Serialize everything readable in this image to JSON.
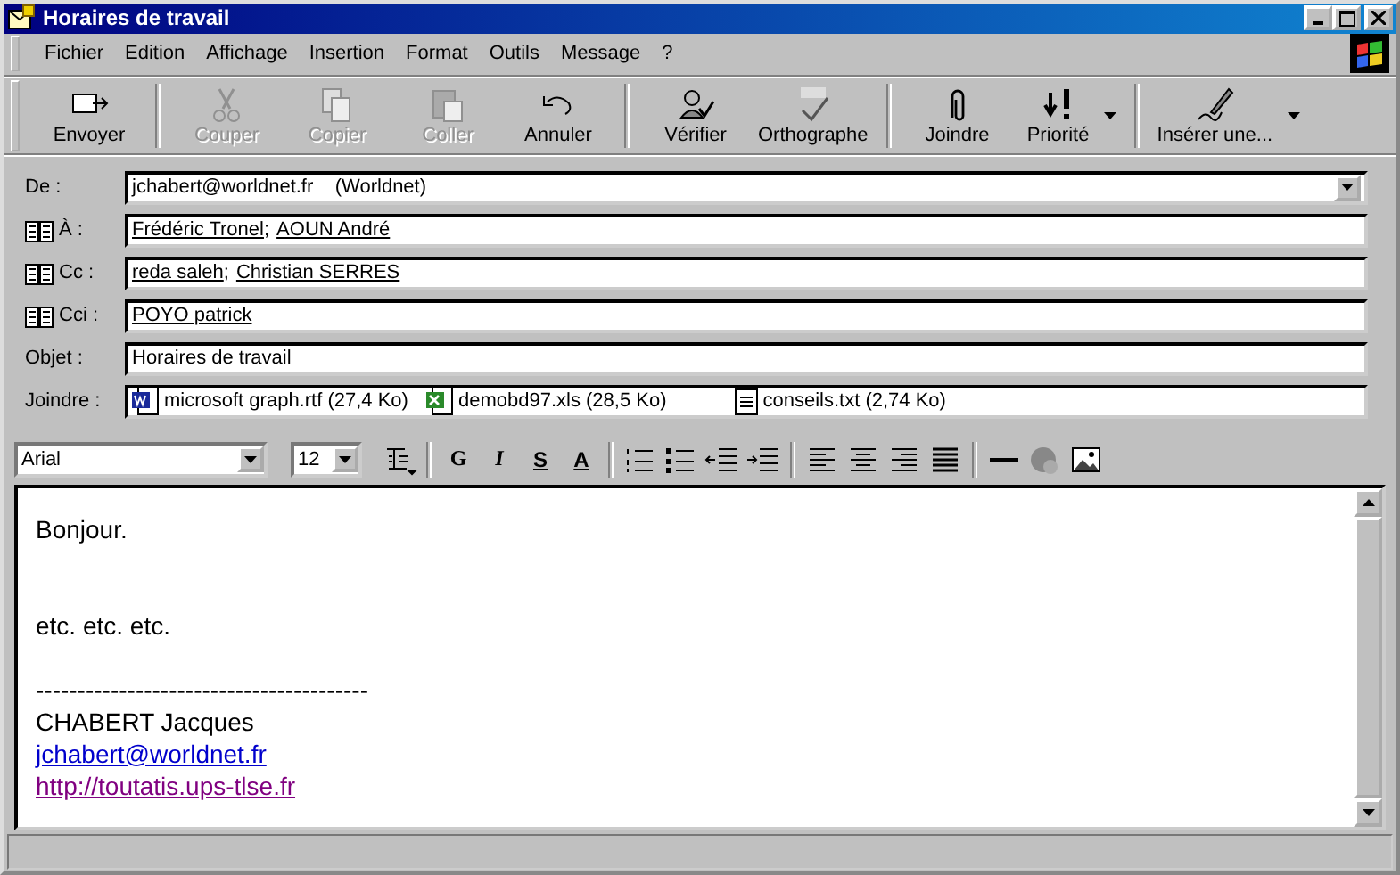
{
  "window": {
    "title": "Horaires de travail"
  },
  "menu": [
    "Fichier",
    "Edition",
    "Affichage",
    "Insertion",
    "Format",
    "Outils",
    "Message",
    "?"
  ],
  "toolbar": [
    [
      {
        "kind": "send",
        "label": "Envoyer",
        "disabled": false,
        "dropdown": false
      }
    ],
    [
      {
        "kind": "cut",
        "label": "Couper",
        "disabled": true,
        "dropdown": false
      },
      {
        "kind": "copy",
        "label": "Copier",
        "disabled": true,
        "dropdown": false
      },
      {
        "kind": "paste",
        "label": "Coller",
        "disabled": true,
        "dropdown": false
      },
      {
        "kind": "undo",
        "label": "Annuler",
        "disabled": false,
        "dropdown": false
      }
    ],
    [
      {
        "kind": "check",
        "label": "Vérifier",
        "disabled": false,
        "dropdown": false
      },
      {
        "kind": "spell",
        "label": "Orthographe",
        "disabled": false,
        "dropdown": false
      }
    ],
    [
      {
        "kind": "attach",
        "label": "Joindre",
        "disabled": false,
        "dropdown": false
      },
      {
        "kind": "priority",
        "label": "Priorité",
        "disabled": false,
        "dropdown": true
      }
    ],
    [
      {
        "kind": "sign",
        "label": "Insérer une...",
        "disabled": false,
        "dropdown": true
      }
    ]
  ],
  "header": {
    "from": {
      "label": "De :",
      "value": "jchabert@worldnet.fr    (Worldnet)"
    },
    "recipients": [
      {
        "label": "À :",
        "names": [
          "Frédéric Tronel",
          "AOUN André"
        ],
        "separator": ";"
      },
      {
        "label": "Cc :",
        "names": [
          "reda saleh",
          "Christian SERRES"
        ],
        "separator": ";"
      },
      {
        "label": "Cci :",
        "names": [
          "POYO patrick"
        ]
      }
    ],
    "subject": {
      "label": "Objet :",
      "value": "Horaires de travail"
    },
    "attachments": {
      "label": "Joindre :",
      "files": [
        {
          "kind": "word",
          "name": "microsoft graph.rtf (27,4 Ko)"
        },
        {
          "kind": "excel",
          "name": "demobd97.xls (28,5 Ko)"
        },
        {
          "kind": "text",
          "name": "conseils.txt (2,74 Ko)"
        }
      ]
    }
  },
  "format_bar": {
    "font": "Arial",
    "size": "12",
    "buttons": [
      {
        "kind": "style"
      },
      {
        "kind": "sep"
      },
      {
        "kind": "bold",
        "text": "G"
      },
      {
        "kind": "italic",
        "text": "I"
      },
      {
        "kind": "underline",
        "text": "S"
      },
      {
        "kind": "font-color",
        "text": "A"
      },
      {
        "kind": "sep"
      },
      {
        "kind": "numbered"
      },
      {
        "kind": "bullets"
      },
      {
        "kind": "outdent"
      },
      {
        "kind": "indent"
      },
      {
        "kind": "sep"
      },
      {
        "kind": "align-left"
      },
      {
        "kind": "align-center"
      },
      {
        "kind": "align-right"
      },
      {
        "kind": "justify"
      },
      {
        "kind": "sep"
      },
      {
        "kind": "hr"
      },
      {
        "kind": "globe"
      },
      {
        "kind": "image"
      }
    ]
  },
  "body": [
    {
      "kind": "text",
      "text": "Bonjour."
    },
    {
      "kind": "blank"
    },
    {
      "kind": "blank"
    },
    {
      "kind": "text",
      "text": "etc. etc. etc."
    },
    {
      "kind": "blank"
    },
    {
      "kind": "text",
      "text": "----------------------------------------"
    },
    {
      "kind": "text",
      "text": "CHABERT Jacques"
    },
    {
      "kind": "link",
      "text": "jchabert@worldnet.fr",
      "visited": false
    },
    {
      "kind": "link",
      "text": "http://toutatis.ups-tlse.fr",
      "visited": true
    }
  ]
}
